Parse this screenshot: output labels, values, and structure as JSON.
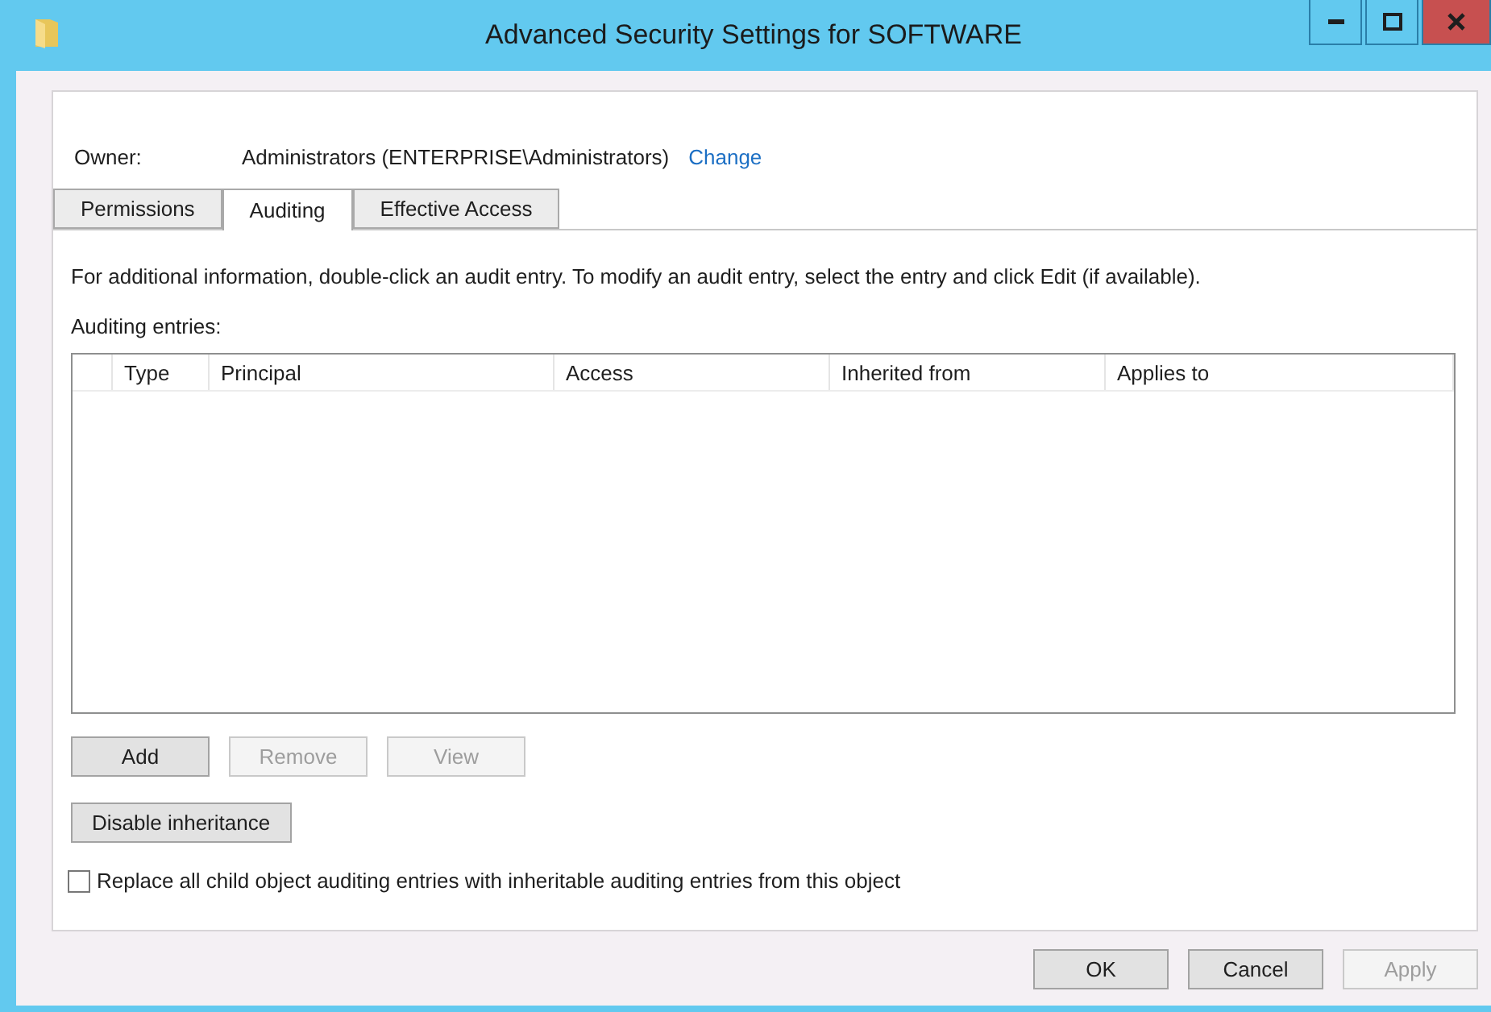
{
  "window": {
    "title": "Advanced Security Settings for SOFTWARE"
  },
  "owner": {
    "label": "Owner:",
    "value": "Administrators (ENTERPRISE\\Administrators)",
    "link": "Change"
  },
  "tabs": [
    {
      "label": "Permissions",
      "selected": false
    },
    {
      "label": "Auditing",
      "selected": true
    },
    {
      "label": "Effective Access",
      "selected": false
    }
  ],
  "description": "For additional information, double-click an audit entry. To modify an audit entry, select the entry and click Edit (if available).",
  "entries_label": "Auditing entries:",
  "table": {
    "columns": [
      "",
      "Type",
      "Principal",
      "Access",
      "Inherited from",
      "Applies to"
    ]
  },
  "entry_buttons": [
    {
      "label": "Add",
      "disabled": false
    },
    {
      "label": "Remove",
      "disabled": true
    },
    {
      "label": "View",
      "disabled": true
    }
  ],
  "inheritance_button": {
    "label": "Disable inheritance",
    "disabled": false
  },
  "replace_checkbox": {
    "label": "Replace all child object auditing entries with inheritable auditing entries from this object",
    "checked": false
  },
  "dialog_buttons": [
    {
      "label": "OK",
      "disabled": false
    },
    {
      "label": "Cancel",
      "disabled": false
    },
    {
      "label": "Apply",
      "disabled": true
    }
  ]
}
